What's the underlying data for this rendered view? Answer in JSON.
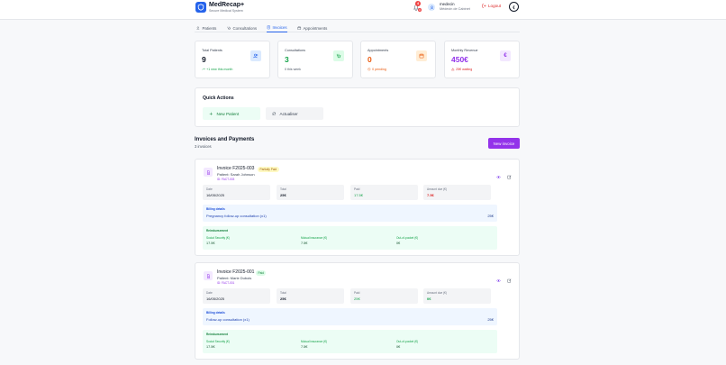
{
  "header": {
    "app_name": "MedRecap+",
    "app_subtitle": "Secure Medical System",
    "notifications_count": "4",
    "notifications_secondary": "0",
    "user_name": "medecin",
    "user_role": "Médecin de Cabinet",
    "logout_label": "Logout"
  },
  "tabs": [
    {
      "label": "Patients",
      "icon": "users-icon",
      "active": false
    },
    {
      "label": "Consultations",
      "icon": "stethoscope-icon",
      "active": false
    },
    {
      "label": "Invoices",
      "icon": "invoice-icon",
      "active": true
    },
    {
      "label": "Appointments",
      "icon": "calendar-icon",
      "active": false
    }
  ],
  "stats": [
    {
      "label": "Total Patients",
      "value": "9",
      "sub": "+1 new this month",
      "value_color": "#111827",
      "sub_color": "#16a34a",
      "icon": "users-icon",
      "icon_bg": "#dbeafe",
      "icon_color": "#2563eb"
    },
    {
      "label": "Consultations",
      "value": "3",
      "sub": "0 this week",
      "value_color": "#16a34a",
      "sub_color": "#4b5563",
      "icon": "stethoscope-icon",
      "icon_bg": "#dcfce7",
      "icon_color": "#16a34a"
    },
    {
      "label": "Appointments",
      "value": "0",
      "sub": "0 pending",
      "value_color": "#ea580c",
      "sub_color": "#ea580c",
      "icon": "calendar-icon",
      "icon_bg": "#ffedd5",
      "icon_color": "#ea580c"
    },
    {
      "label": "Monthly Revenue",
      "value": "450€",
      "sub": "25€ waiting",
      "value_color": "#9333ea",
      "sub_color": "#dc2626",
      "icon": "euro-icon",
      "icon_bg": "#f3e8ff",
      "icon_color": "#9333ea"
    }
  ],
  "quick_actions": {
    "title": "Quick Actions",
    "new_patient": "New Patient",
    "refresh": "Actualiser"
  },
  "invoices_section": {
    "title": "Invoices and Payments",
    "count": "3 invoices",
    "new_invoice": "New invoice"
  },
  "labels": {
    "date": "Date",
    "total": "Total",
    "paid": "Paid",
    "amount_due": "Amount due (€)",
    "billing_details": "Billing details",
    "reimbursement": "Reimbursement",
    "social_security": "Social Security (€)",
    "mutual_insurance": "Mutual insurance (€)",
    "out_of_pocket": "Out-of-pocket (€)"
  },
  "invoices": [
    {
      "title": "Invoice F2025-003",
      "patient": "Patient: Sarah Johnson",
      "id": "ID: FACT-003",
      "status": "Partially Paid",
      "date": "16/05/2025",
      "total": "25€",
      "paid": "17.5€",
      "due": "7.5€",
      "billing_desc": "Pregnancy follow-up consultation (x1)",
      "billing_amount": "25€",
      "social_security": "17.5€",
      "mutual_insurance": "7.5€",
      "out_of_pocket": "0€"
    },
    {
      "title": "Invoice F2025-001",
      "patient": "Patient: Marie Dubois",
      "id": "ID: FACT-001",
      "status": "Paid",
      "date": "16/05/2025",
      "total": "25€",
      "paid": "25€",
      "due": "0€",
      "billing_desc": "Follow-up consultation (x1)",
      "billing_amount": "25€",
      "social_security": "17.5€",
      "mutual_insurance": "7.5€",
      "out_of_pocket": "0€"
    }
  ]
}
